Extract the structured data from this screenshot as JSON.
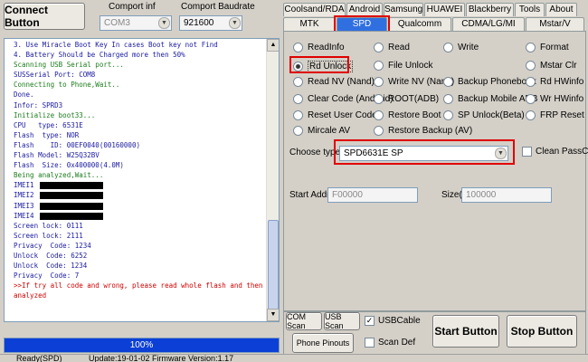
{
  "header": {
    "connect_label": "Connect Button",
    "comport_label": "Comport inf",
    "baud_label": "Comport Baudrate",
    "comport_value": "COM3",
    "baud_value": "921600"
  },
  "tabs_row1": [
    {
      "label": "Coolsand/RDA"
    },
    {
      "label": "Android"
    },
    {
      "label": "Samsung"
    },
    {
      "label": "HUAWEI"
    },
    {
      "label": "Blackberry"
    },
    {
      "label": "Tools"
    },
    {
      "label": "About"
    }
  ],
  "tabs_row2": [
    {
      "label": "MTK"
    },
    {
      "label": "SPD"
    },
    {
      "label": "Qualcomm"
    },
    {
      "label": "CDMA/LG/MI"
    },
    {
      "label": "Mstar/V"
    }
  ],
  "options": [
    {
      "label": "ReadInfo"
    },
    {
      "label": "Read"
    },
    {
      "label": "Write"
    },
    {
      "label": "Format"
    },
    {
      "label": "Rd Unlock"
    },
    {
      "label": "File Unlock"
    },
    {
      "label": "Mstar Clr"
    },
    {
      "label": "Read NV (Nand)"
    },
    {
      "label": "Write NV (Nand)"
    },
    {
      "label": "Backup Phonebook"
    },
    {
      "label": "Rd HWinfo"
    },
    {
      "label": "Clear Code (Android)"
    },
    {
      "label": "ROOT(ADB)"
    },
    {
      "label": "Backup Mobile ADB"
    },
    {
      "label": "Wr HWinfo"
    },
    {
      "label": "Reset User Code"
    },
    {
      "label": "Restore Boot"
    },
    {
      "label": "SP Unlock(Beta)"
    },
    {
      "label": "FRP Reset"
    },
    {
      "label": "Mircale AV"
    },
    {
      "label": "Restore Backup (AV)"
    }
  ],
  "choose_type_label": "Choose  type",
  "choose_type_value": "SPD6631E SP",
  "clean_passcode_label": "Clean PassCode",
  "start_addr_label": "Start Addr(0",
  "start_addr_value": "F00000",
  "size_label": "Size(0",
  "size_value": "100000",
  "log_lines": [
    "3. Use Miracle Boot Key In cases Boot key not Find",
    "4. Battery Should be Charged more then 50%",
    "Scanning USB Serial port...",
    "SUSSerial Port: COM8",
    "Connecting to Phone,Wait..",
    "Done.",
    "Infor: SPRD3",
    "Initialize boot33...",
    "CPU   type: 6531E",
    "Flash  type: NOR",
    "Flash    ID: 00EF0040(00160000)",
    "Flash Model: W25Q32BV",
    "Flash  Size: 0x400000(4.0M)",
    "Being analyzed,Wait...",
    "IMEI1",
    "IMEI2",
    "IMEI3",
    "IMEI4",
    "Screen lock: 0111",
    "Screen lock: 2111",
    "Privacy  Code: 1234",
    "Unlock  Code: 6252",
    "Unlock  Code: 1234",
    "Privacy  Code: 7",
    ">>If try all code and wrong, please read whole flash and then",
    "analyzed"
  ],
  "progress_text": "100%",
  "progress_value": 1.0,
  "bottom": {
    "com_scan": "COM Scan",
    "usb_scan": "USB Scan",
    "usb_cable": "USBCable",
    "phone_pinouts": "Phone Pinouts",
    "scan_def": "Scan Def",
    "start": "Start Button",
    "stop": "Stop Button"
  },
  "status": {
    "ready": "Ready(SPD)",
    "update": "Update:19-01-02  Firmware Version:1.17"
  },
  "colors": {
    "accent": "#2f6fe0",
    "highlight": "#e00000",
    "log_blue": "#1a1aa0",
    "log_green": "#1c7c1c",
    "log_red": "#d00000"
  }
}
